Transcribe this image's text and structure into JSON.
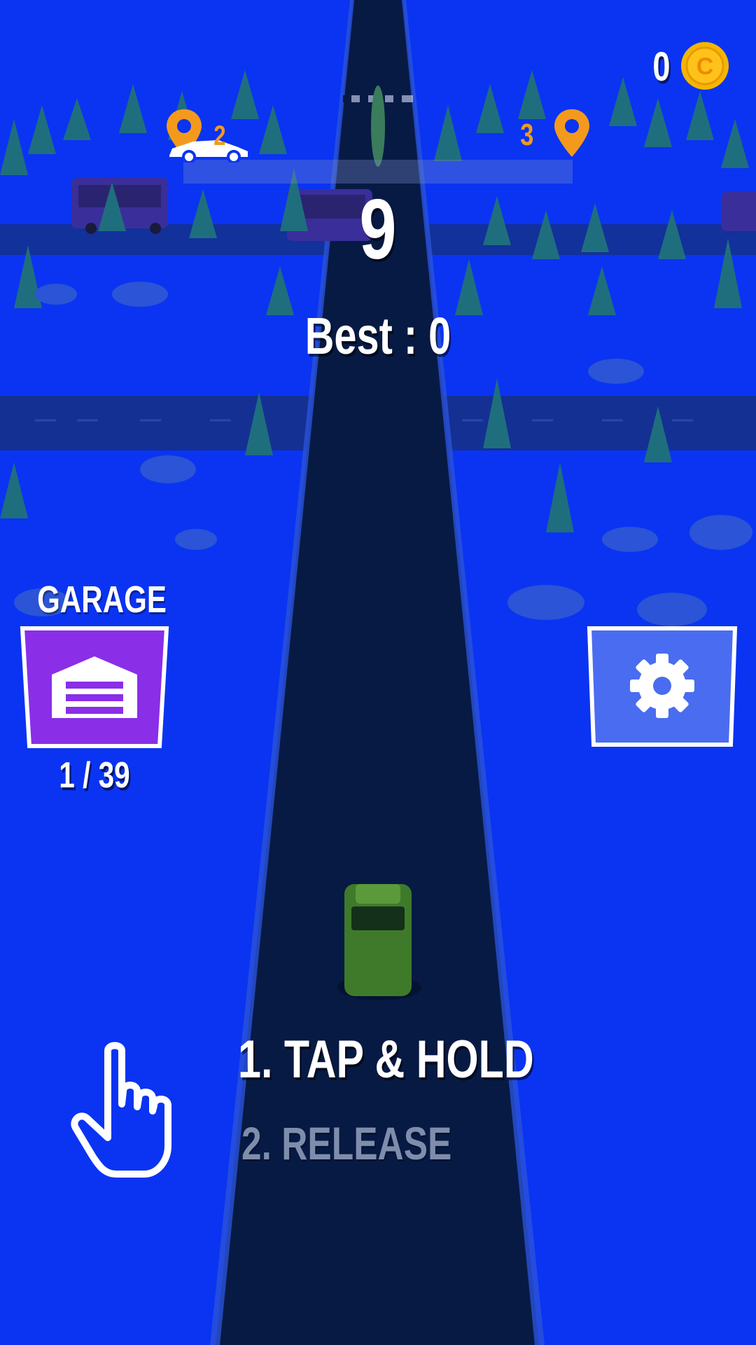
{
  "hud": {
    "score": "9",
    "best": "Best : 0",
    "coins": "0",
    "coin_symbol": "C"
  },
  "progress": {
    "current_level": "2",
    "next_level": "3",
    "fraction": 0.0
  },
  "garage": {
    "label": "GARAGE",
    "count": "1 / 39"
  },
  "tutorial": {
    "step1": "1. TAP & HOLD",
    "step2": "2. RELEASE"
  },
  "colors": {
    "background": "#0a34f2",
    "road": "#071a44",
    "accent_orange": "#f39a1c",
    "garage_purple": "#8a2ee8",
    "settings_blue": "#4a6cf0",
    "coin_gold": "#f7b500"
  },
  "icons": {
    "coin": "coin-icon",
    "map_pin": "map-pin-icon",
    "garage": "garage-door-icon",
    "settings": "gear-icon",
    "hand": "tap-hand-icon"
  }
}
